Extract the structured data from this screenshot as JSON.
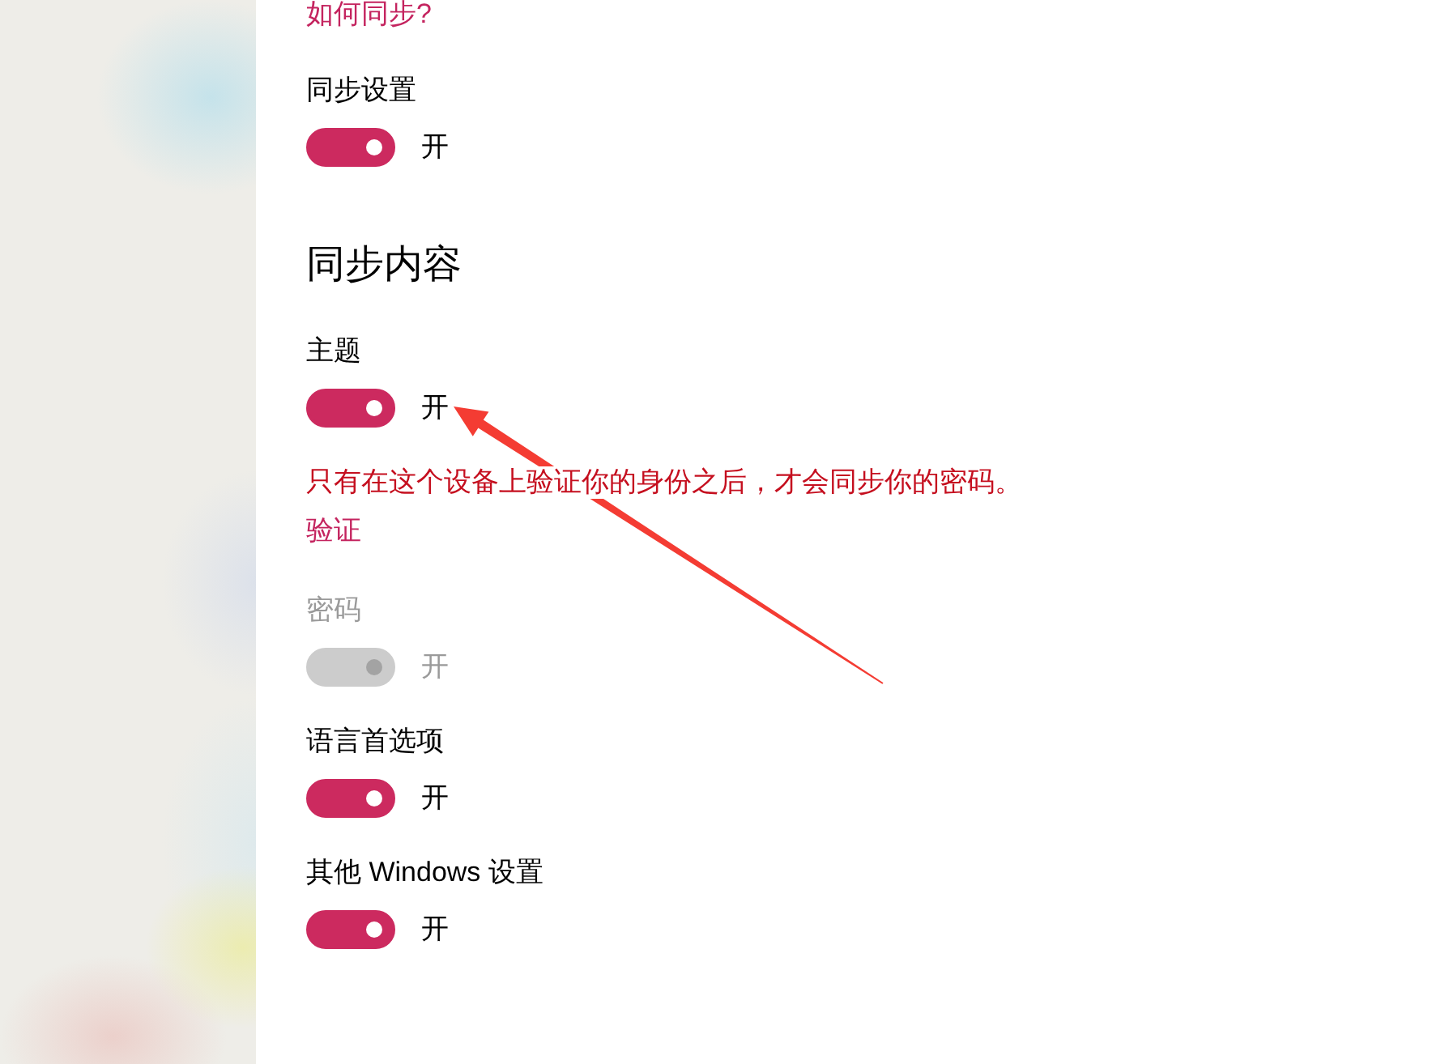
{
  "help_link": {
    "text": "如何同步?"
  },
  "sync_settings": {
    "label": "同步设置",
    "on": true,
    "state_text": "开"
  },
  "section_title": "同步内容",
  "items": [
    {
      "kind": "toggle",
      "label": "主题",
      "on": true,
      "disabled": false,
      "state_text": "开"
    },
    {
      "kind": "notice",
      "text": "只有在这个设备上验证你的身份之后，才会同步你的密码。",
      "link": "验证"
    },
    {
      "kind": "toggle",
      "label": "密码",
      "on": true,
      "disabled": true,
      "state_text": "开"
    },
    {
      "kind": "toggle",
      "label": "语言首选项",
      "on": true,
      "disabled": false,
      "state_text": "开"
    },
    {
      "kind": "toggle",
      "label": "其他 Windows 设置",
      "on": true,
      "disabled": false,
      "state_text": "开"
    }
  ]
}
